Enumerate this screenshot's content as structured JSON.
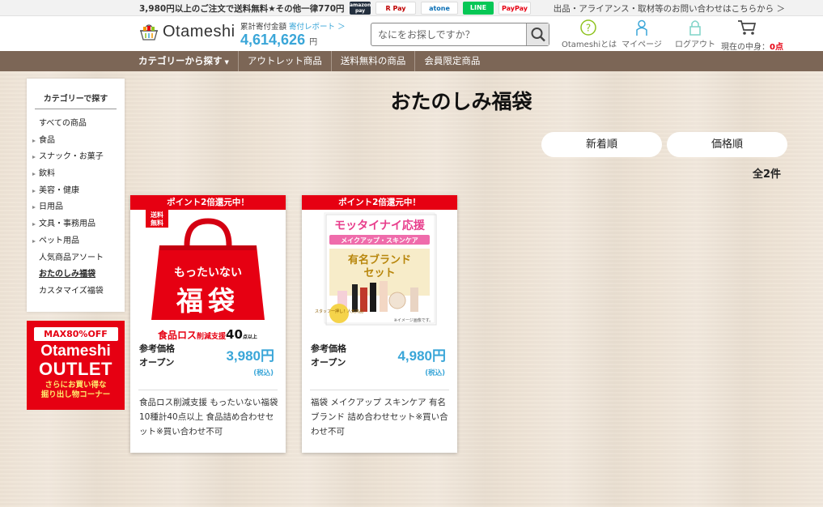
{
  "topbar": {
    "promo": "3,980円以上のご注文で送料無料★その他一律770円",
    "payments": [
      "amazon pay",
      "R Pay",
      "atone",
      "LINE Pay",
      "PayPay"
    ],
    "contact": "出品・アライアンス・取材等のお問い合わせはこちらから ＞"
  },
  "header": {
    "logo": "Otameshi",
    "donation_label": "累計寄付金額",
    "donation_link": "寄付レポート ＞",
    "donation_amount": "4,614,626",
    "donation_unit": "円",
    "search_placeholder": "なにをお探しですか？",
    "icons": [
      {
        "label": "Otameshiとは",
        "icon": "question-icon"
      },
      {
        "label": "マイページ",
        "icon": "person-icon"
      },
      {
        "label": "ログアウト",
        "icon": "lock-icon"
      }
    ],
    "cart_label": "現在の中身：",
    "cart_count": "0点"
  },
  "nav": {
    "items": [
      "カテゴリーから探す",
      "アウトレット商品",
      "送料無料の商品",
      "会員限定商品"
    ]
  },
  "sidebar": {
    "heading": "カテゴリーで探す",
    "items": [
      {
        "label": "すべての商品",
        "arrow": false
      },
      {
        "label": "食品",
        "arrow": true
      },
      {
        "label": "スナック・お菓子",
        "arrow": true
      },
      {
        "label": "飲料",
        "arrow": true
      },
      {
        "label": "美容・健康",
        "arrow": true
      },
      {
        "label": "日用品",
        "arrow": true
      },
      {
        "label": "文具・事務用品",
        "arrow": true
      },
      {
        "label": "ペット用品",
        "arrow": true
      },
      {
        "label": "人気商品アソート",
        "arrow": false
      },
      {
        "label": "おたのしみ福袋",
        "arrow": false,
        "active": true
      },
      {
        "label": "カスタマイズ福袋",
        "arrow": false
      }
    ]
  },
  "outlet_banner": {
    "badge": "MAX80%OFF",
    "line1": "Otameshi",
    "line2": "OUTLET",
    "sub1": "さらにお買い得な",
    "sub2": "掘り出し物コーナー"
  },
  "main": {
    "title": "おたのしみ福袋",
    "sort": [
      "新着順",
      "価格順"
    ],
    "count": "全2件"
  },
  "products": [
    {
      "ribbon": "ポイント2倍還元中！",
      "image_text": {
        "badge": "送料無料",
        "line1": "もったいない",
        "line2": "福袋",
        "bottom": "食品ロス削減支援40",
        "bottom_pre": "食品ロス",
        "bottom_mid": "削減支援",
        "bottom_num": "40",
        "bottom_unit": "点以上"
      },
      "ref_label": "参考価格",
      "ref_value": "オープン",
      "price": "3,980円",
      "tax": "(税込)",
      "desc": "食品ロス削減支援 もったいない福袋 10種計40点以上 食品詰め合わせセット※買い合わせ不可"
    },
    {
      "ribbon": "ポイント2倍還元中！",
      "image_text": {
        "line1": "モッタイナイ応援",
        "line2": "メイクアップ・スキンケア",
        "line3": "有名ブランド",
        "line4": "セット",
        "note": "※イメージ画像です。",
        "seal": "スタッフ一押し！人気商品"
      },
      "ref_label": "参考価格",
      "ref_value": "オープン",
      "price": "4,980円",
      "tax": "(税込)",
      "desc": "福袋 メイクアップ スキンケア 有名ブランド 詰め合わせセット※買い合わせ不可"
    }
  ],
  "colors": {
    "brand_red": "#e60012",
    "accent_blue": "#3aa6d8",
    "nav_brown": "#7c6656"
  }
}
